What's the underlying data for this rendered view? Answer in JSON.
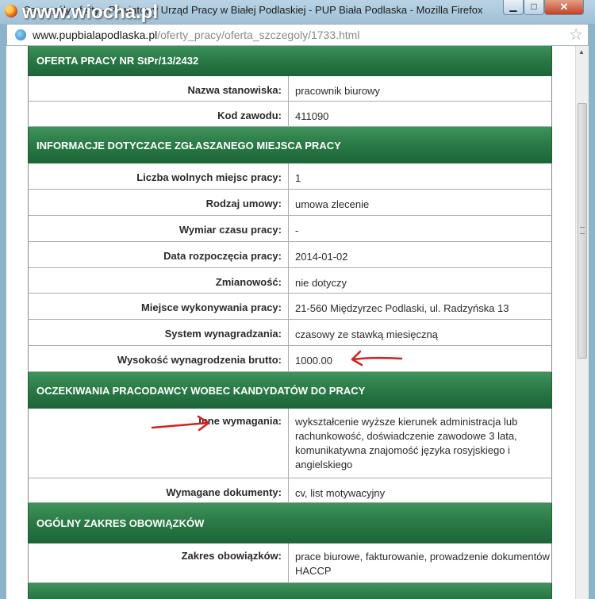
{
  "window": {
    "title": "Szczegóły oferty - Powiatowy Urząd Pracy w Białej Podlaskiej - PUP Biała Podlaska - Mozilla Firefox",
    "watermark": "www.wiocha.pl",
    "buttons": {
      "minimize": "▁",
      "maximize": "□",
      "close": "✕"
    }
  },
  "address": {
    "host": "www.pupbialapodlaska.pl",
    "path": "/oferty_pracy/oferta_szczegoly/1733.html"
  },
  "offer": {
    "header": "OFERTA PRACY NR StPr/13/2432",
    "rows": [
      {
        "label": "Nazwa stanowiska:",
        "value": "pracownik biurowy"
      },
      {
        "label": "Kod zawodu:",
        "value": "411090"
      }
    ]
  },
  "workplace": {
    "header": "INFORMACJE DOTYCZACE ZGŁASZANEGO MIEJSCA PRACY",
    "rows": [
      {
        "label": "Liczba wolnych miejsc pracy:",
        "value": "1"
      },
      {
        "label": "Rodzaj umowy:",
        "value": "umowa zlecenie"
      },
      {
        "label": "Wymiar czasu pracy:",
        "value": "-"
      },
      {
        "label": "Data rozpoczęcia pracy:",
        "value": "2014-01-02"
      },
      {
        "label": "Zmianowość:",
        "value": "nie dotyczy"
      },
      {
        "label": "Miejsce wykonywania pracy:",
        "value": "21-560 Międzyrzec Podlaski, ul. Radzyńska 13"
      },
      {
        "label": "System wynagradzania:",
        "value": "czasowy ze stawką miesięczną"
      },
      {
        "label": "Wysokość wynagrodzenia brutto:",
        "value": "1000.00"
      }
    ]
  },
  "expectations": {
    "header": "OCZEKIWANIA PRACODAWCY WOBEC KANDYDATÓW DO PRACY",
    "rows": [
      {
        "label": "Inne wymagania:",
        "value": "wykształcenie wyższe kierunek administracja lub rachunkowość, doświadczenie zawodowe 3 lata, komunikatywna znajomość języka rosyjskiego i angielskiego"
      },
      {
        "label": "Wymagane dokumenty:",
        "value": "cv, list motywacyjny"
      }
    ]
  },
  "duties": {
    "header": "OGÓLNY ZAKRES OBOWIĄZKÓW",
    "rows": [
      {
        "label": "Zakres obowiązków:",
        "value": "prace biurowe, fakturowanie, prowadzenie dokumentów HACCP"
      }
    ]
  },
  "colors": {
    "section_header": "#2b7b47",
    "annotation": "#d42020"
  }
}
